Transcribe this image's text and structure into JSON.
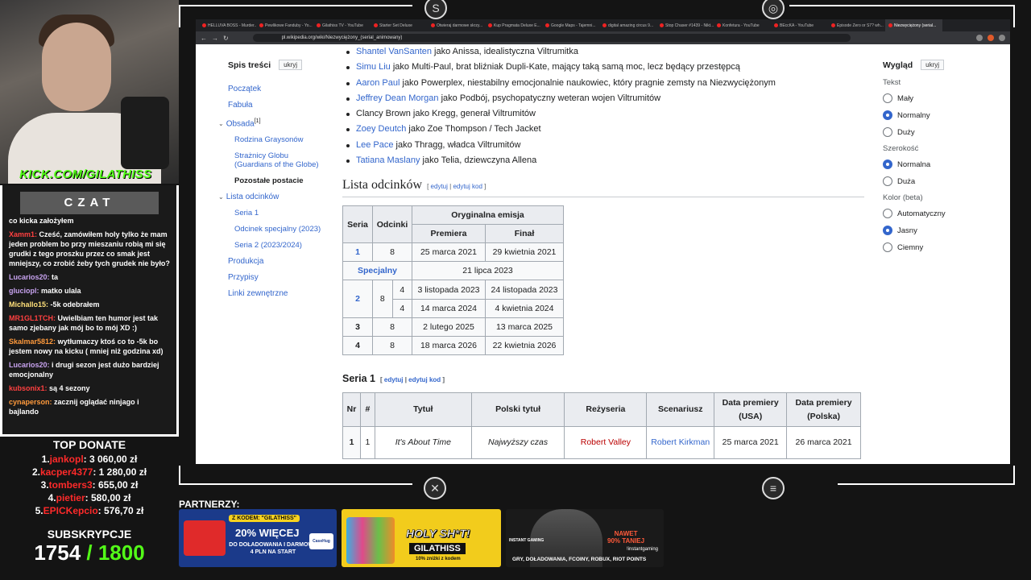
{
  "stream": {
    "kick_banner": "KICK.COM/GILATHISS",
    "chat_title": "CZAT",
    "chat": [
      {
        "user": "",
        "text": "co kicka założyłem",
        "color": "plain"
      },
      {
        "user": "Xamm1:",
        "text": "Cześć, zamówiłem holy tylko że mam jeden problem bo przy mieszaniu robią mi się grudki z tego proszku przez co smak jest mniejszy, co zrobić żeby tych grudek nie było?",
        "color": "red"
      },
      {
        "user": "Lucarios20:",
        "text": "ta",
        "color": "purple"
      },
      {
        "user": "gluciopl:",
        "text": "matko ulala",
        "color": "purple"
      },
      {
        "user": "Michallo15:",
        "text": "-5k odebrałem",
        "color": "yellow"
      },
      {
        "user": "MR1GL1TCH:",
        "text": "Uwielbiam ten humor jest tak samo zjebany jak mój bo to mój XD :)",
        "color": "red"
      },
      {
        "user": "Skalmar5812:",
        "text": "wytłumaczy ktoś co to -5k bo jestem nowy na kicku ( mniej niż godzina xd)",
        "color": "orange"
      },
      {
        "user": "Lucarios20:",
        "text": "i drugi sezon jest dużo bardziej emocjonalny",
        "color": "purple"
      },
      {
        "user": "kubsonix1:",
        "text": "są 4 sezony",
        "color": "red"
      },
      {
        "user": "cynaperson:",
        "text": "zacznij oglądać ninjago i bajlando",
        "color": "orange"
      }
    ],
    "top_donate_title": "TOP DONATE",
    "top_donate": [
      {
        "rank": "1.",
        "name": "jankopl",
        "amount": ": 3 060,00 zł"
      },
      {
        "rank": "2.",
        "name": "kacper4377",
        "amount": ": 1 280,00 zł"
      },
      {
        "rank": "3.",
        "name": "tombers3",
        "amount": ": 655,00 zł"
      },
      {
        "rank": "4.",
        "name": "pietier",
        "amount": ": 580,00 zł"
      },
      {
        "rank": "5.",
        "name": "EPICKepcio",
        "amount": ": 576,70 zł"
      }
    ],
    "subs_title": "SUBSKRYPCJE",
    "subs_count": "1754",
    "subs_goal": " / 1800",
    "partners_label": "PARTNERZY:",
    "ads": {
      "ad1_code": "Z KODEM: \"GILATHISS\"",
      "ad1_main": "20% WIĘCEJ",
      "ad1_sub": "DO DOŁADOWANIA I DARMOWE 4 PLN NA START",
      "ad1_brand": "CaseHug",
      "ad2_main": "HOLY SH*T!",
      "ad2_name": "GILATHISS",
      "ad2_sub": "10% zniżki z kodem",
      "ad3_brand": "INSTANT GAMING",
      "ad3_promo_1": "NAWET",
      "ad3_promo_2": "90% TANIEJ",
      "ad3_sub": "!instantgaming",
      "ad3_bottom": "GRY, DOŁADOWANIA, FCOINY, ROBUX, RIOT POINTS"
    }
  },
  "browser": {
    "tabs": [
      "HELLUVA BOSS - Murder...",
      "Pewlikowe Fanduby - Yo...",
      "Gilathiss TV - YouTube",
      "Starter Set Deluxe",
      "Otwieraj darmowe skrzy...",
      "Kup Pragmata Deluxe E...",
      "Google Maps - Tajemni...",
      "digital amazing circus 9...",
      "Stop Chaser #1439 - Nikt...",
      "Konfetura - YouTube",
      "BEccKA - YouTube",
      "Episode Zero or S7? wh...",
      "Niezwyciężony (serial..."
    ],
    "url": "pl.wikipedia.org/wiki/Niezwyciężony_(serial_animowany)"
  },
  "toc": {
    "title": "Spis treści",
    "hide": "ukryj",
    "items": [
      {
        "label": "Początek",
        "level": 0
      },
      {
        "label": "Fabuła",
        "level": 0
      },
      {
        "label": "Obsada",
        "sup": "[1]",
        "level": 0,
        "chev": true
      },
      {
        "label": "Rodzina Graysonów",
        "level": 1
      },
      {
        "label": "Strażnicy Globu (Guardians of the Globe)",
        "level": 1
      },
      {
        "label": "Pozostałe postacie",
        "level": 1,
        "current": true
      },
      {
        "label": "Lista odcinków",
        "level": 0,
        "chev": true
      },
      {
        "label": "Seria 1",
        "level": 1
      },
      {
        "label": "Odcinek specjalny (2023)",
        "level": 1
      },
      {
        "label": "Seria 2 (2023/2024)",
        "level": 1
      },
      {
        "label": "Produkcja",
        "level": 0
      },
      {
        "label": "Przypisy",
        "level": 0
      },
      {
        "label": "Linki zewnętrzne",
        "level": 0
      }
    ]
  },
  "cast": [
    {
      "actor": "Shantel VanSanten",
      "role": " jako Anissa, idealistyczna Viltrumitka",
      "link": true
    },
    {
      "actor": "Simu Liu",
      "role": " jako Multi-Paul, brat bliźniak Dupli-Kate, mający taką samą moc, lecz będący przestępcą",
      "link": true
    },
    {
      "actor": "Aaron Paul",
      "role": " jako Powerplex, niestabilny emocjonalnie naukowiec, który pragnie zemsty na Niezwyciężonym",
      "link": true
    },
    {
      "actor": "Jeffrey Dean Morgan",
      "role": " jako Podbój, psychopatyczny weteran wojen Viltrumitów",
      "link": true
    },
    {
      "actor": "Clancy Brown",
      "role": " jako Kregg, generał Viltrumitów",
      "link": false
    },
    {
      "actor": "Zoey Deutch",
      "role": " jako Zoe Thompson / Tech Jacket",
      "link": true
    },
    {
      "actor": "Lee Pace",
      "role": " jako Thragg, władca Viltrumitów",
      "link": true
    },
    {
      "actor": "Tatiana Maslany",
      "role": " jako Telia, dziewczyna Allena",
      "link": true
    }
  ],
  "episodes_section": {
    "title": "Lista odcinków",
    "edit": "edytuj",
    "sep": " | ",
    "edit_code": "edytuj kod",
    "headers": {
      "season": "Seria",
      "episodes": "Odcinki",
      "original": "Oryginalna emisja",
      "premiere": "Premiera",
      "finale": "Finał"
    },
    "rows": {
      "s1": {
        "season": "1",
        "episodes": "8",
        "premiere": "25 marca 2021",
        "finale": "29 kwietnia 2021"
      },
      "special": {
        "season": "Specjalny",
        "date": "21 lipca 2023"
      },
      "s2": {
        "season": "2",
        "episodes": "8",
        "part1_eps": "4",
        "part1_premiere": "3 listopada 2023",
        "part1_finale": "24 listopada 2023",
        "part2_eps": "4",
        "part2_premiere": "14 marca 2024",
        "part2_finale": "4 kwietnia 2024"
      },
      "s3": {
        "season": "3",
        "episodes": "8",
        "premiere": "2 lutego 2025",
        "finale": "13 marca 2025"
      },
      "s4": {
        "season": "4",
        "episodes": "8",
        "premiere": "18 marca 2026",
        "finale": "22 kwietnia 2026"
      }
    }
  },
  "season1_section": {
    "title": "Seria 1",
    "edit": "edytuj",
    "sep": " | ",
    "edit_code": "edytuj kod",
    "headers": {
      "nr": "Nr",
      "num": "#",
      "title": "Tytuł",
      "pl_title": "Polski tytuł",
      "director": "Reżyseria",
      "writer": "Scenariusz",
      "date_usa": "Data premiery (USA)",
      "date_pl": "Data premiery (Polska)"
    },
    "row1": {
      "nr": "1",
      "num": "1",
      "title": "It's About Time",
      "pl_title": "Najwyższy czas",
      "director": "Robert Valley",
      "writer": "Robert Kirkman",
      "date_usa": "25 marca 2021",
      "date_pl": "26 marca 2021"
    }
  },
  "appearance": {
    "title": "Wygląd",
    "hide": "ukryj",
    "text_label": "Tekst",
    "text_options": [
      {
        "label": "Mały",
        "on": false
      },
      {
        "label": "Normalny",
        "on": true
      },
      {
        "label": "Duży",
        "on": false
      }
    ],
    "width_label": "Szerokość",
    "width_options": [
      {
        "label": "Normalna",
        "on": true
      },
      {
        "label": "Duża",
        "on": false
      }
    ],
    "color_label": "Kolor (beta)",
    "color_options": [
      {
        "label": "Automatyczny",
        "on": false
      },
      {
        "label": "Jasny",
        "on": true
      },
      {
        "label": "Ciemny",
        "on": false
      }
    ]
  }
}
